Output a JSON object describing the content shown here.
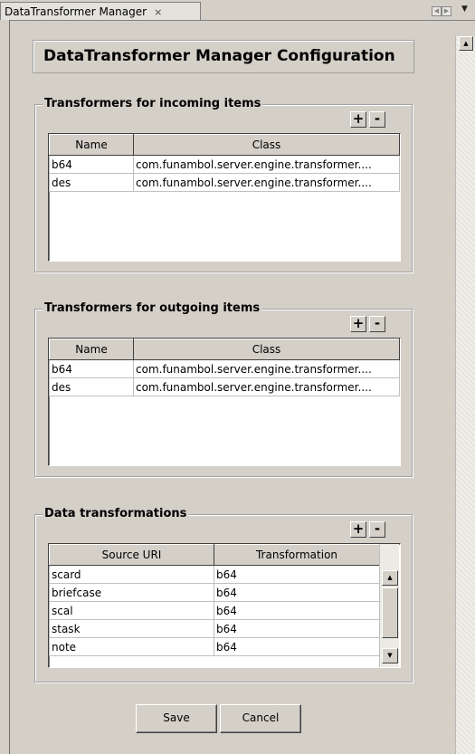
{
  "tab": {
    "label": "DataTransformer Manager",
    "close": "×"
  },
  "page_title": "DataTransformer Manager Configuration",
  "add_label": "+",
  "remove_label": "-",
  "incoming": {
    "title": "Transformers for incoming items",
    "columns": [
      "Name",
      "Class"
    ],
    "rows": [
      [
        "b64",
        "com.funambol.server.engine.transformer...."
      ],
      [
        "des",
        "com.funambol.server.engine.transformer...."
      ]
    ]
  },
  "outgoing": {
    "title": "Transformers for outgoing items",
    "columns": [
      "Name",
      "Class"
    ],
    "rows": [
      [
        "b64",
        "com.funambol.server.engine.transformer...."
      ],
      [
        "des",
        "com.funambol.server.engine.transformer...."
      ]
    ]
  },
  "transformations": {
    "title": "Data transformations",
    "columns": [
      "Source URI",
      "Transformation"
    ],
    "rows": [
      [
        "scard",
        "b64"
      ],
      [
        "briefcase",
        "b64"
      ],
      [
        "scal",
        "b64"
      ],
      [
        "stask",
        "b64"
      ],
      [
        "note",
        "b64"
      ]
    ]
  },
  "buttons": {
    "save": "Save",
    "cancel": "Cancel"
  },
  "icons": {
    "nav_left": "triangle-left-icon",
    "nav_right": "triangle-right-icon",
    "dropdown": "triangle-down-icon",
    "scroll_up": "triangle-up-icon",
    "scroll_down": "triangle-down-icon"
  }
}
